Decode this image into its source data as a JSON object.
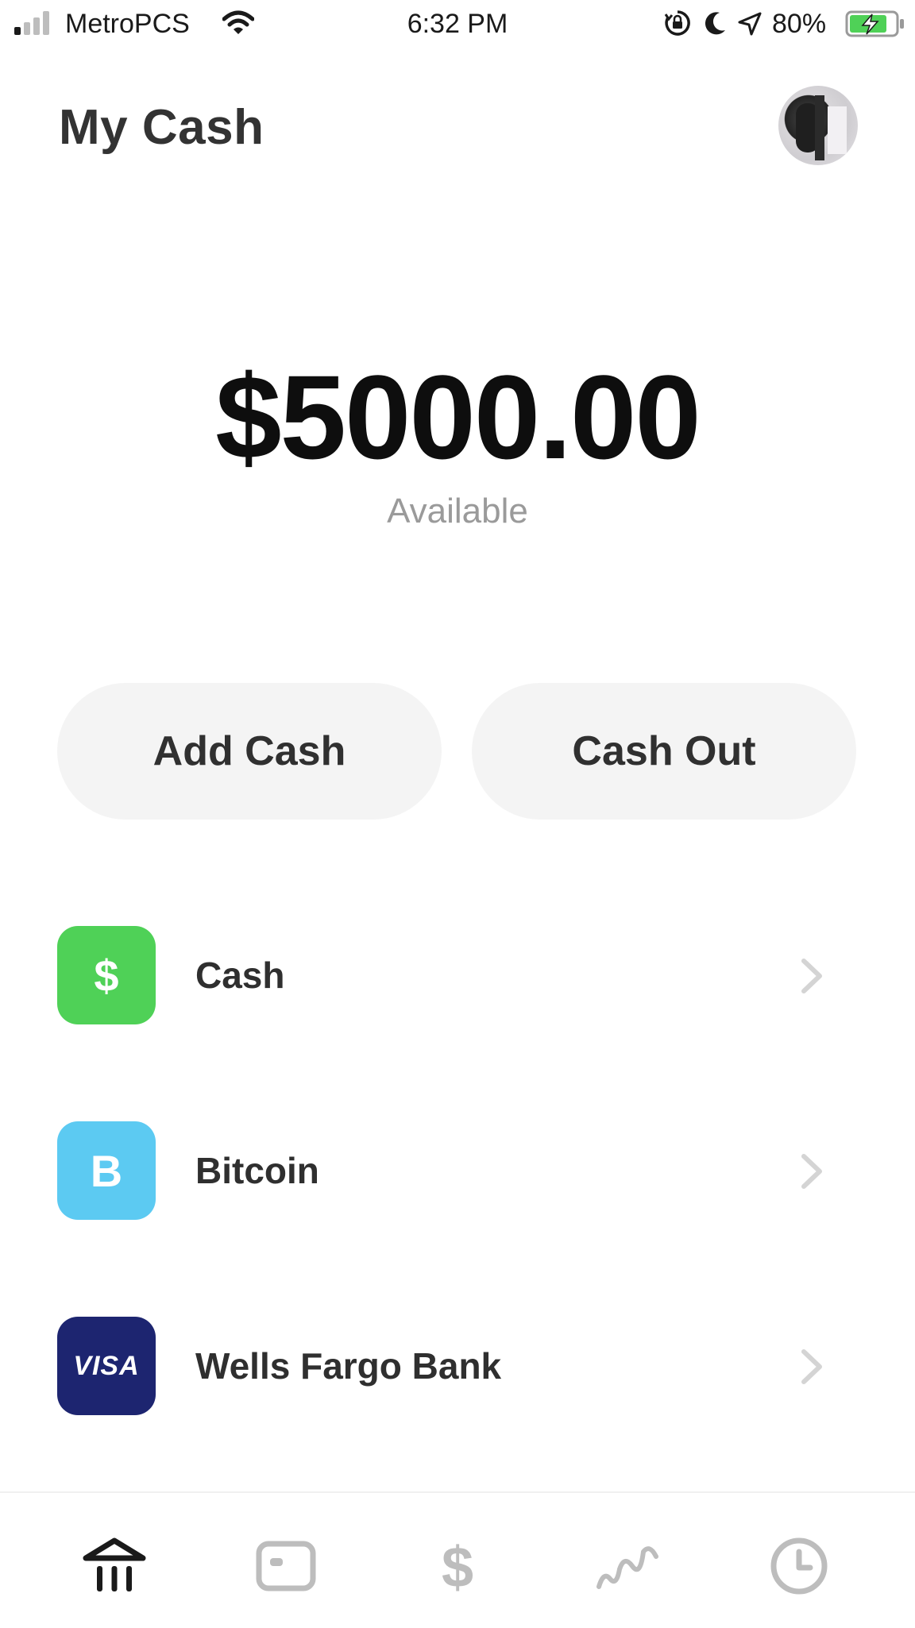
{
  "status_bar": {
    "carrier": "MetroPCS",
    "time": "6:32 PM",
    "battery_percent": "80%",
    "signal_bars_filled": 1,
    "signal_bars_total": 4,
    "icons": [
      "signal-icon",
      "wifi-icon",
      "orientation-lock-icon",
      "moon-icon",
      "location-icon",
      "battery-charging-icon"
    ]
  },
  "header": {
    "title": "My Cash",
    "avatar_icon": "profile-avatar"
  },
  "balance": {
    "amount": "$5000.00",
    "label": "Available"
  },
  "actions": {
    "add_cash": "Add Cash",
    "cash_out": "Cash Out"
  },
  "accounts": [
    {
      "label": "Cash",
      "icon_text": "$",
      "icon": "cash-dollar-icon",
      "color": "#4fd157"
    },
    {
      "label": "Bitcoin",
      "icon_text": "B",
      "icon": "bitcoin-icon",
      "color": "#5ccaf2"
    },
    {
      "label": "Wells Fargo Bank",
      "icon_text": "VISA",
      "icon": "visa-card-icon",
      "color": "#1d2570"
    }
  ],
  "bottom_nav": {
    "items": [
      {
        "icon": "bank-home-icon",
        "active": true
      },
      {
        "icon": "card-icon",
        "active": false
      },
      {
        "icon": "dollar-icon",
        "active": false
      },
      {
        "icon": "investing-icon",
        "active": false
      },
      {
        "icon": "activity-clock-icon",
        "active": false
      }
    ],
    "active_color": "#1a1a1a",
    "inactive_color": "#bdbdbd"
  }
}
